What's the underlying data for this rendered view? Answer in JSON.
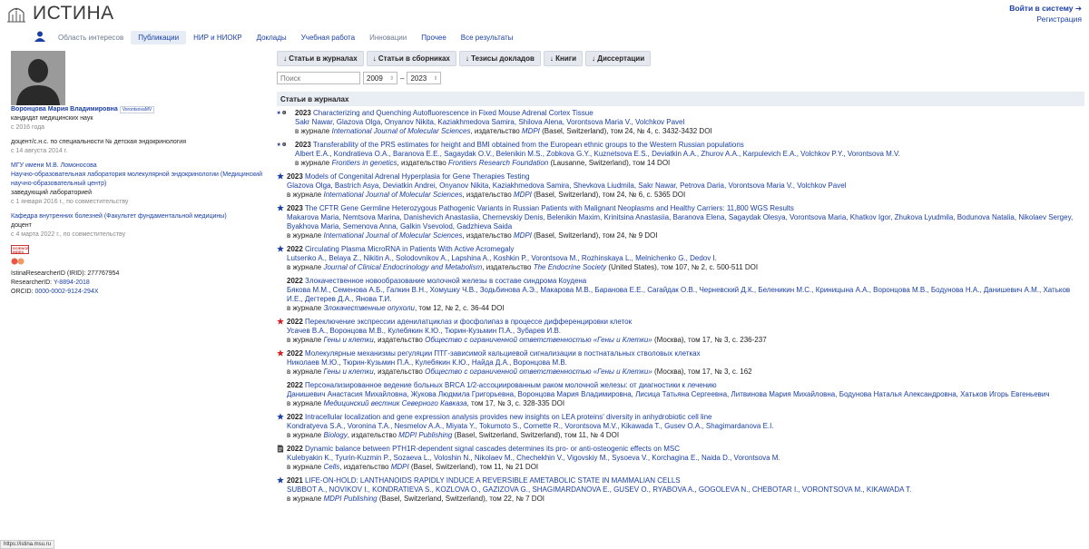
{
  "header": {
    "brand": "ИСТИНА",
    "login": "Войти в систему ➔",
    "register": "Регистрация"
  },
  "nav": [
    {
      "label": "Область интересов",
      "state": "dim"
    },
    {
      "label": "Публикации",
      "state": "active"
    },
    {
      "label": "НИР и НИОКР",
      "state": ""
    },
    {
      "label": "Доклады",
      "state": ""
    },
    {
      "label": "Учебная работа",
      "state": ""
    },
    {
      "label": "Инновации",
      "state": "dim"
    },
    {
      "label": "Прочее",
      "state": ""
    },
    {
      "label": "Все результаты",
      "state": ""
    }
  ],
  "profile": {
    "name": "Воронцова Мария Владимировна",
    "nick": "VorontsovaMV",
    "degree": "кандидат медицинских наук",
    "degree_since": "с 2016 года",
    "docent": "доцент/с.н.с. по специальности № детская эндокринология",
    "docent_since": "с 14 августа 2014 г.",
    "org": "МГУ имени М.В. Ломоносова",
    "lab": "Научно-образовательная лаборатория молекулярной эндокринологии (Медицинский научно-образовательный центр)",
    "lab_role": "заведующий лабораторией",
    "lab_since": "с 1 января 2016 г., по совместительству",
    "dept": "Кафедра внутренних болезней (Факультет фундаментальной медицины)",
    "dept_role": "доцент",
    "dept_since": "с 4 марта 2022 г., по совместительству",
    "badge_text": "SCIENCE INDEX",
    "irid": "IstinaResearcherID (IRID): 277767954",
    "researcher_label": "ResearcherID: ",
    "researcher": "Y-8894-2018",
    "orcid_label": "ORCID: ",
    "orcid": "0000-0002-9124-294X"
  },
  "buttons": [
    "↓ Статьи в журналах",
    "↓ Статьи в сборниках",
    "↓ Тезисы докладов",
    "↓ Книги",
    "↓ Диссертации"
  ],
  "filter": {
    "search_placeholder": "Поиск",
    "year_from": "2009",
    "dash": "–",
    "year_to": "2023"
  },
  "section_title": "Статьи в журналах",
  "pubs": [
    {
      "marker": "star-globe",
      "year": "2023",
      "title": "Characterizing and Quenching Autofluorescence in Fixed Mouse Adrenal Cortex Tissue",
      "authors": "Sakr Nawar, Glazova Olga, Onyanov Nikita, Kaziakhmedova Samira, Shilova Alena, Vorontsova Maria V., Volchkov Pavel",
      "meta_pre": "в журнале ",
      "journal": "International Journal of Molecular Sciences",
      "meta_mid": ", издательство ",
      "publisher": "MDPI",
      "meta_post": " (Basel, Switzerland), том 24, № 4, с. 3432-3432 DOI"
    },
    {
      "marker": "star-globe",
      "year": "2023",
      "title": "Transferability of the PRS estimates for height and BMI obtained from the European ethnic groups to the Western Russian populations",
      "authors": "Albert E.A., Kondratieva O.A., Baranova E.E., Sagaydak O.V., Belenikin M.S., Zobkova G.Y., Kuznetsova E.S., Deviatkin A.A., Zhurov A.A., Karpulevich E.A., Volchkov P.Y., Vorontsova M.V.",
      "meta_pre": "в журнале ",
      "journal": "Frontiers in genetics",
      "meta_mid": ", издательство ",
      "publisher": "Frontiers Research Foundation",
      "meta_post": " (Lausanne, Switzerland), том 14 DOI"
    },
    {
      "marker": "star",
      "year": "2023",
      "title": "Models of Congenital Adrenal Hyperplasia for Gene Therapies Testing",
      "authors": "Glazova Olga, Bastrich Asya, Deviatkin Andrei, Onyanov Nikita, Kaziakhmedova Samira, Shevkova Liudmila, Sakr Nawar, Petrova Daria, Vorontsova Maria V., Volchkov Pavel",
      "meta_pre": "в журнале ",
      "journal": "International Journal of Molecular Sciences",
      "meta_mid": ", издательство ",
      "publisher": "MDPI",
      "meta_post": " (Basel, Switzerland), том 24, № 6, с. 5365 DOI"
    },
    {
      "marker": "star",
      "year": "2023",
      "title": "The CFTR Gene Germline Heterozygous Pathogenic Variants in Russian Patients with Malignant Neoplasms and Healthy Carriers: 11,800 WGS Results",
      "authors": "Makarova Maria, Nemtsova Marina, Danishevich Anastasiia, Chernevskiy Denis, Belenikin Maxim, Krinitsina Anastasiia, Baranova Elena, Sagaydak Olesya, Vorontsova Maria, Khatkov Igor, Zhukova Lyudmila, Bodunova Natalia, Nikolaev Sergey, Byakhova Maria, Semenova Anna, Galkin Vsevolod, Gadzhieva Saida",
      "meta_pre": "в журнале ",
      "journal": "International Journal of Molecular Sciences",
      "meta_mid": ", издательство ",
      "publisher": "MDPI",
      "meta_post": " (Basel, Switzerland), том 24, № 9 DOI"
    },
    {
      "marker": "star",
      "year": "2022",
      "title": "Circulating Plasma MicroRNA in Patients With Active Acromegaly",
      "authors": "Lutsenko A., Belaya Z., Nikitin A., Solodovnikov A., Lapshina A., Koshkin P., Vorontsova M., Rozhinskaya L., Melnichenko G., Dedov I.",
      "meta_pre": "в журнале ",
      "journal": "Journal of Clinical Endocrinology and Metabolism",
      "meta_mid": ", издательство ",
      "publisher": "The Endocrine Society",
      "meta_post": " (United States), том 107, № 2, с. 500-511 DOI"
    },
    {
      "marker": "none",
      "year": "2022",
      "title": "Злокачественное новообразование молочной железы в составе синдрома Коудена",
      "authors": "Бякова М.М., Семенова А.Б., Галкин В.Н., Хомушку Ч.В., Зодьбинова А.Э., Макарова М.В., Баранова Е.Е., Сагайдак О.В., Черневский Д.К., Беленикин М.С., Криницына А.А., Воронцова М.В., Бодунова Н.А., Данишевич А.М., Хатьков И.Е., Дегтерев Д.А., Янова Т.И.",
      "meta_pre": "в журнале ",
      "journal": "Злокачественные опухоли",
      "meta_mid": "",
      "publisher": "",
      "meta_post": ", том 12, № 2, с. 36-44 DOI"
    },
    {
      "marker": "red-star",
      "year": "2022",
      "title": "Переключение экспрессии аденилатциклаз и фосфолипаз в процессе дифференцировки клеток",
      "authors": "Усачев В.А., Воронцова М.В., Кулебякин К.Ю., Тюрин-Кузьмин П.А., Зубарев И.В.",
      "meta_pre": "в журнале ",
      "journal": "Гены и клетки",
      "meta_mid": ", издательство ",
      "publisher": "Общество с ограниченной ответственностью «Гены и Клетки»",
      "meta_post": " (Москва), том 17, № 3, с. 236-237"
    },
    {
      "marker": "red-star",
      "year": "2022",
      "title": "Молекулярные механизмы регуляции ПТГ-зависимой кальциевой сигнализации в постнатальных стволовых клетках",
      "authors": "Николаев М.Ю., Тюрин-Кузьмин П.А., Кулебякин К.Ю., Найда Д.А., Воронцова М.В.",
      "meta_pre": "в журнале ",
      "journal": "Гены и клетки",
      "meta_mid": ", издательство ",
      "publisher": "Общество с ограниченной ответственностью «Гены и Клетки»",
      "meta_post": " (Москва), том 17, № 3, с. 162"
    },
    {
      "marker": "none",
      "year": "2022",
      "title": "Персонализированное ведение больных BRCA 1/2-ассоциированным раком молочной железы: от диагностики к лечению",
      "authors": "Данишевич Анастасия Михайловна, Жукова Людмила Григорьевна, Воронцова Мария Владимировна, Лисица Татьяна Сергеевна, Литвинова Мария Михайловна, Бодунова Наталья Александровна, Хатьков Игорь Евгеньевич",
      "meta_pre": "в журнале ",
      "journal": "Медицинский вестник Северного Кавказа",
      "meta_mid": "",
      "publisher": "",
      "meta_post": ", том 17, № 3, с. 328-335 DOI"
    },
    {
      "marker": "star",
      "year": "2022",
      "title": "Intracellular localization and gene expression analysis provides new insights on LEA proteins' diversity in anhydrobiotic cell line",
      "authors": "Kondratyeva S.A., Voronina T.A., Nesmelov A.A., Miyata Y., Tokumoto S., Cornette R., Vorontsova M.V., Kikawada T., Gusev O.A., Shagimardanova E.I.",
      "meta_pre": "в журнале ",
      "journal": "Biology",
      "meta_mid": ", издательство ",
      "publisher": "MDPI Publishing",
      "meta_post": " (Basel, Switzerland, Switzerland), том 11, № 4 DOI"
    },
    {
      "marker": "doc",
      "year": "2022",
      "title": "Dynamic balance between PTH1R-dependent signal cascades determines its pro- or anti-osteogenic effects on MSC",
      "authors": "Kulebyakin K., Tyurin-Kuzmin P., Sozaeva L., Voloshin N., Nikolaev M., Chechekhin V., Vigovskiy M., Sysoeva V., Korchagina E., Naida D., Vorontsova M.",
      "meta_pre": "в журнале ",
      "journal": "Cells",
      "meta_mid": ", издательство ",
      "publisher": "MDPI",
      "meta_post": " (Basel, Switzerland), том 11, № 21 DOI"
    },
    {
      "marker": "star",
      "year": "2021",
      "title": "LIFE-ON-HOLD: LANTHANOIDS RAPIDLY INDUCE A REVERSIBLE AMETABOLIC STATE IN MAMMALIAN CELLS",
      "authors": "SUBBOT A., NOVIKOV I., KONDRATIEVA S., KOZLOVA O., GAZIZOVA G., SHAGIMARDANOVA E., GUSEV O., RYABOVA A., GOGOLEVA N., CHEBOTAR I., VORONTSOVA M., KIKAWADA T.",
      "meta_pre": "в журнале ",
      "journal": "",
      "meta_mid": "",
      "publisher": "MDPI Publishing",
      "meta_post": " (Basel, Switzerland, Switzerland), том 22, № 7 DOI"
    }
  ],
  "statusbar": "https://istina.msu.ru"
}
